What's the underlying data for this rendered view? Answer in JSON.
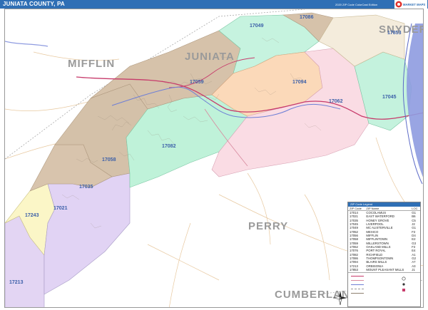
{
  "header": {
    "title": "JUNIATA COUNTY, PA",
    "edition": "2020 ZIP Code ColorCast Edition",
    "logo_text": "MARKET MAPS"
  },
  "counties": {
    "mifflin": "MIFFLIN",
    "juniata": "JUNIATA",
    "snyder": "SNYDER",
    "perry": "PERRY",
    "cumberland": "CUMBERLAND"
  },
  "zip_labels": {
    "z17086": "17086",
    "z17049": "17049",
    "z17853": "17853",
    "z17059": "17059",
    "z17094": "17094",
    "z17045": "17045",
    "z17062": "17062",
    "z17082": "17082",
    "z17058": "17058",
    "z17035": "17035",
    "z17243": "17243",
    "z17021": "17021",
    "z17213": "17213"
  },
  "legend": {
    "header": "ZIP Code Legend",
    "columns": [
      "ZIP Code",
      "ZIP Name",
      "LOC"
    ],
    "rows": [
      [
        "17014",
        "COCOLAMUS",
        "G1"
      ],
      [
        "17021",
        "EAST WATERFORD",
        "B6"
      ],
      [
        "17035",
        "HONEY GROVE",
        "C5"
      ],
      [
        "17045",
        "LIVERPOOL",
        "J2"
      ],
      [
        "17049",
        "MC ALISTERVILLE",
        "G1"
      ],
      [
        "17052",
        "MEXICO",
        "F2"
      ],
      [
        "17056",
        "MIFFLIN",
        "D4"
      ],
      [
        "17058",
        "MIFFLINTOWN",
        "E2"
      ],
      [
        "17059",
        "MILLERSTOWN",
        "G3"
      ],
      [
        "17062",
        "OAKLAND MILLS",
        "F2"
      ],
      [
        "17076",
        "PORT ROYAL",
        "E4"
      ],
      [
        "17082",
        "RICHFIELD",
        "A1"
      ],
      [
        "17086",
        "THOMPSONTOWN",
        "G2"
      ],
      [
        "17094",
        "BLAIRS MILLS",
        "A7"
      ],
      [
        "17213",
        "ORBISONIA",
        "A3"
      ],
      [
        "17853",
        "MOUNT PLEASANT MILLS",
        "J1"
      ]
    ]
  },
  "colors": {
    "brand": "#2f6fb5",
    "county_label": "#9a9a9a",
    "zip_label": "#3b5fa8",
    "highway": "#c73b6b",
    "river": "#6e7fd6"
  }
}
